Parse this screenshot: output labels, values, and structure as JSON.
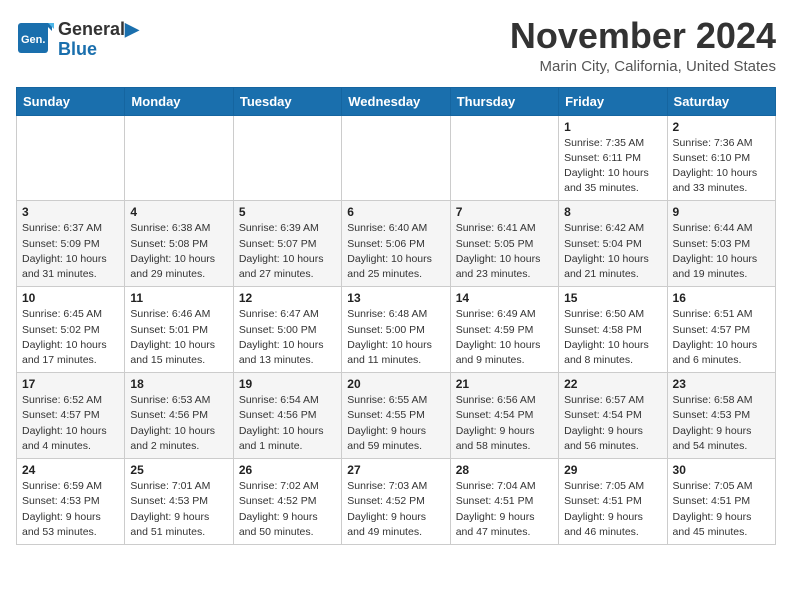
{
  "header": {
    "logo_line1": "General",
    "logo_line2": "Blue",
    "month": "November 2024",
    "location": "Marin City, California, United States"
  },
  "weekdays": [
    "Sunday",
    "Monday",
    "Tuesday",
    "Wednesday",
    "Thursday",
    "Friday",
    "Saturday"
  ],
  "weeks": [
    [
      {
        "day": "",
        "info": ""
      },
      {
        "day": "",
        "info": ""
      },
      {
        "day": "",
        "info": ""
      },
      {
        "day": "",
        "info": ""
      },
      {
        "day": "",
        "info": ""
      },
      {
        "day": "1",
        "info": "Sunrise: 7:35 AM\nSunset: 6:11 PM\nDaylight: 10 hours\nand 35 minutes."
      },
      {
        "day": "2",
        "info": "Sunrise: 7:36 AM\nSunset: 6:10 PM\nDaylight: 10 hours\nand 33 minutes."
      }
    ],
    [
      {
        "day": "3",
        "info": "Sunrise: 6:37 AM\nSunset: 5:09 PM\nDaylight: 10 hours\nand 31 minutes."
      },
      {
        "day": "4",
        "info": "Sunrise: 6:38 AM\nSunset: 5:08 PM\nDaylight: 10 hours\nand 29 minutes."
      },
      {
        "day": "5",
        "info": "Sunrise: 6:39 AM\nSunset: 5:07 PM\nDaylight: 10 hours\nand 27 minutes."
      },
      {
        "day": "6",
        "info": "Sunrise: 6:40 AM\nSunset: 5:06 PM\nDaylight: 10 hours\nand 25 minutes."
      },
      {
        "day": "7",
        "info": "Sunrise: 6:41 AM\nSunset: 5:05 PM\nDaylight: 10 hours\nand 23 minutes."
      },
      {
        "day": "8",
        "info": "Sunrise: 6:42 AM\nSunset: 5:04 PM\nDaylight: 10 hours\nand 21 minutes."
      },
      {
        "day": "9",
        "info": "Sunrise: 6:44 AM\nSunset: 5:03 PM\nDaylight: 10 hours\nand 19 minutes."
      }
    ],
    [
      {
        "day": "10",
        "info": "Sunrise: 6:45 AM\nSunset: 5:02 PM\nDaylight: 10 hours\nand 17 minutes."
      },
      {
        "day": "11",
        "info": "Sunrise: 6:46 AM\nSunset: 5:01 PM\nDaylight: 10 hours\nand 15 minutes."
      },
      {
        "day": "12",
        "info": "Sunrise: 6:47 AM\nSunset: 5:00 PM\nDaylight: 10 hours\nand 13 minutes."
      },
      {
        "day": "13",
        "info": "Sunrise: 6:48 AM\nSunset: 5:00 PM\nDaylight: 10 hours\nand 11 minutes."
      },
      {
        "day": "14",
        "info": "Sunrise: 6:49 AM\nSunset: 4:59 PM\nDaylight: 10 hours\nand 9 minutes."
      },
      {
        "day": "15",
        "info": "Sunrise: 6:50 AM\nSunset: 4:58 PM\nDaylight: 10 hours\nand 8 minutes."
      },
      {
        "day": "16",
        "info": "Sunrise: 6:51 AM\nSunset: 4:57 PM\nDaylight: 10 hours\nand 6 minutes."
      }
    ],
    [
      {
        "day": "17",
        "info": "Sunrise: 6:52 AM\nSunset: 4:57 PM\nDaylight: 10 hours\nand 4 minutes."
      },
      {
        "day": "18",
        "info": "Sunrise: 6:53 AM\nSunset: 4:56 PM\nDaylight: 10 hours\nand 2 minutes."
      },
      {
        "day": "19",
        "info": "Sunrise: 6:54 AM\nSunset: 4:56 PM\nDaylight: 10 hours\nand 1 minute."
      },
      {
        "day": "20",
        "info": "Sunrise: 6:55 AM\nSunset: 4:55 PM\nDaylight: 9 hours\nand 59 minutes."
      },
      {
        "day": "21",
        "info": "Sunrise: 6:56 AM\nSunset: 4:54 PM\nDaylight: 9 hours\nand 58 minutes."
      },
      {
        "day": "22",
        "info": "Sunrise: 6:57 AM\nSunset: 4:54 PM\nDaylight: 9 hours\nand 56 minutes."
      },
      {
        "day": "23",
        "info": "Sunrise: 6:58 AM\nSunset: 4:53 PM\nDaylight: 9 hours\nand 54 minutes."
      }
    ],
    [
      {
        "day": "24",
        "info": "Sunrise: 6:59 AM\nSunset: 4:53 PM\nDaylight: 9 hours\nand 53 minutes."
      },
      {
        "day": "25",
        "info": "Sunrise: 7:01 AM\nSunset: 4:53 PM\nDaylight: 9 hours\nand 51 minutes."
      },
      {
        "day": "26",
        "info": "Sunrise: 7:02 AM\nSunset: 4:52 PM\nDaylight: 9 hours\nand 50 minutes."
      },
      {
        "day": "27",
        "info": "Sunrise: 7:03 AM\nSunset: 4:52 PM\nDaylight: 9 hours\nand 49 minutes."
      },
      {
        "day": "28",
        "info": "Sunrise: 7:04 AM\nSunset: 4:51 PM\nDaylight: 9 hours\nand 47 minutes."
      },
      {
        "day": "29",
        "info": "Sunrise: 7:05 AM\nSunset: 4:51 PM\nDaylight: 9 hours\nand 46 minutes."
      },
      {
        "day": "30",
        "info": "Sunrise: 7:05 AM\nSunset: 4:51 PM\nDaylight: 9 hours\nand 45 minutes."
      }
    ]
  ]
}
